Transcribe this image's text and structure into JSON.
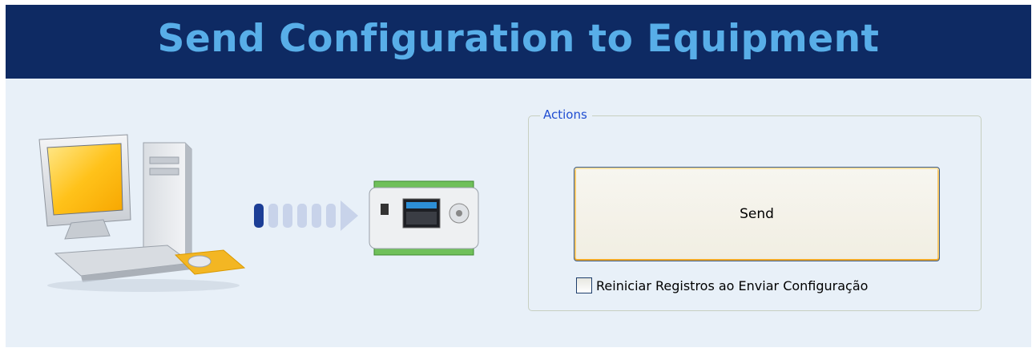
{
  "header": {
    "title": "Send Configuration to Equipment"
  },
  "illustration": {
    "computer_icon": "desktop-computer-icon",
    "arrow_icon": "transfer-progress-arrow-icon",
    "device_icon": "controller-device-icon",
    "progress_steps_total": 6,
    "progress_steps_active": 1
  },
  "actions": {
    "legend": "Actions",
    "send_label": "Send",
    "reset_checkbox_label": "Reiniciar Registros ao Enviar Configuração",
    "reset_checked": false
  },
  "colors": {
    "header_bg": "#0e2a63",
    "title_text": "#58aee8",
    "content_bg": "#e8f0f8",
    "legend_text": "#1f4dd1",
    "button_focus": "#f0a828"
  }
}
